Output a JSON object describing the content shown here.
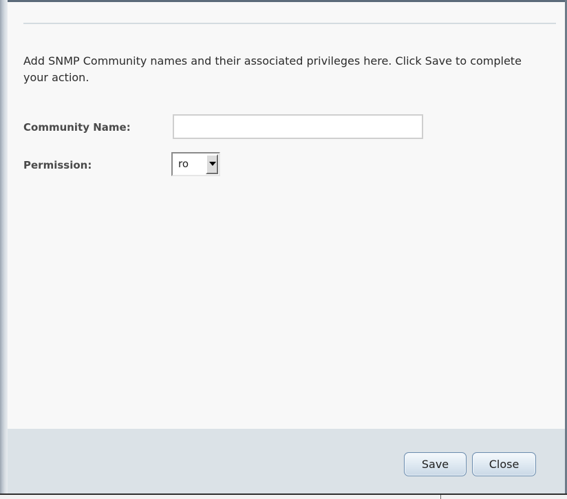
{
  "dialog": {
    "instructions": "Add SNMP Community names and their associated privileges here. Click Save to complete your action."
  },
  "form": {
    "community_name": {
      "label": "Community Name:",
      "value": ""
    },
    "permission": {
      "label": "Permission:",
      "selected": "ro",
      "arrow_icon": "chevron-down-icon"
    }
  },
  "footer": {
    "save_label": "Save",
    "close_label": "Close"
  },
  "colors": {
    "footer_background": "#dbe2e7",
    "button_border": "#6b8cae",
    "divider": "#d4dbe0"
  }
}
